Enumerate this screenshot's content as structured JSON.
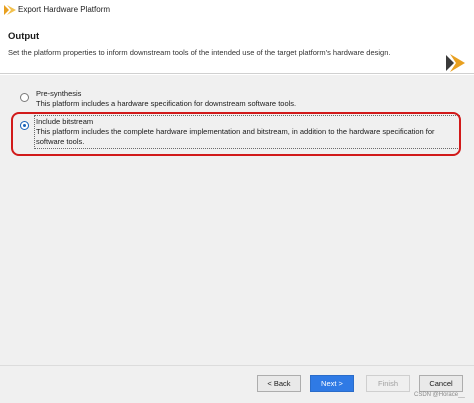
{
  "window": {
    "title": "Export Hardware Platform",
    "logo_icon": "vivado-logo-icon"
  },
  "header": {
    "title": "Output",
    "description": "Set the platform properties to inform downstream tools of the intended use of the target platform's hardware design.",
    "logo_icon": "vivado-logo-icon"
  },
  "options": [
    {
      "label": "Pre-synthesis",
      "description": "This platform includes a hardware specification for downstream software tools.",
      "selected": false
    },
    {
      "label": "Include bitstream",
      "description": "This platform includes the complete hardware implementation and bitstream, in addition to the hardware specification for software tools.",
      "selected": true
    }
  ],
  "buttons": {
    "back": "< Back",
    "next": "Next >",
    "finish": "Finish",
    "cancel": "Cancel"
  },
  "watermark": "CSDN @Horace__",
  "colors": {
    "accent": "#2f7ae5",
    "highlight": "#d11a1a",
    "logo": "#e8a020"
  }
}
